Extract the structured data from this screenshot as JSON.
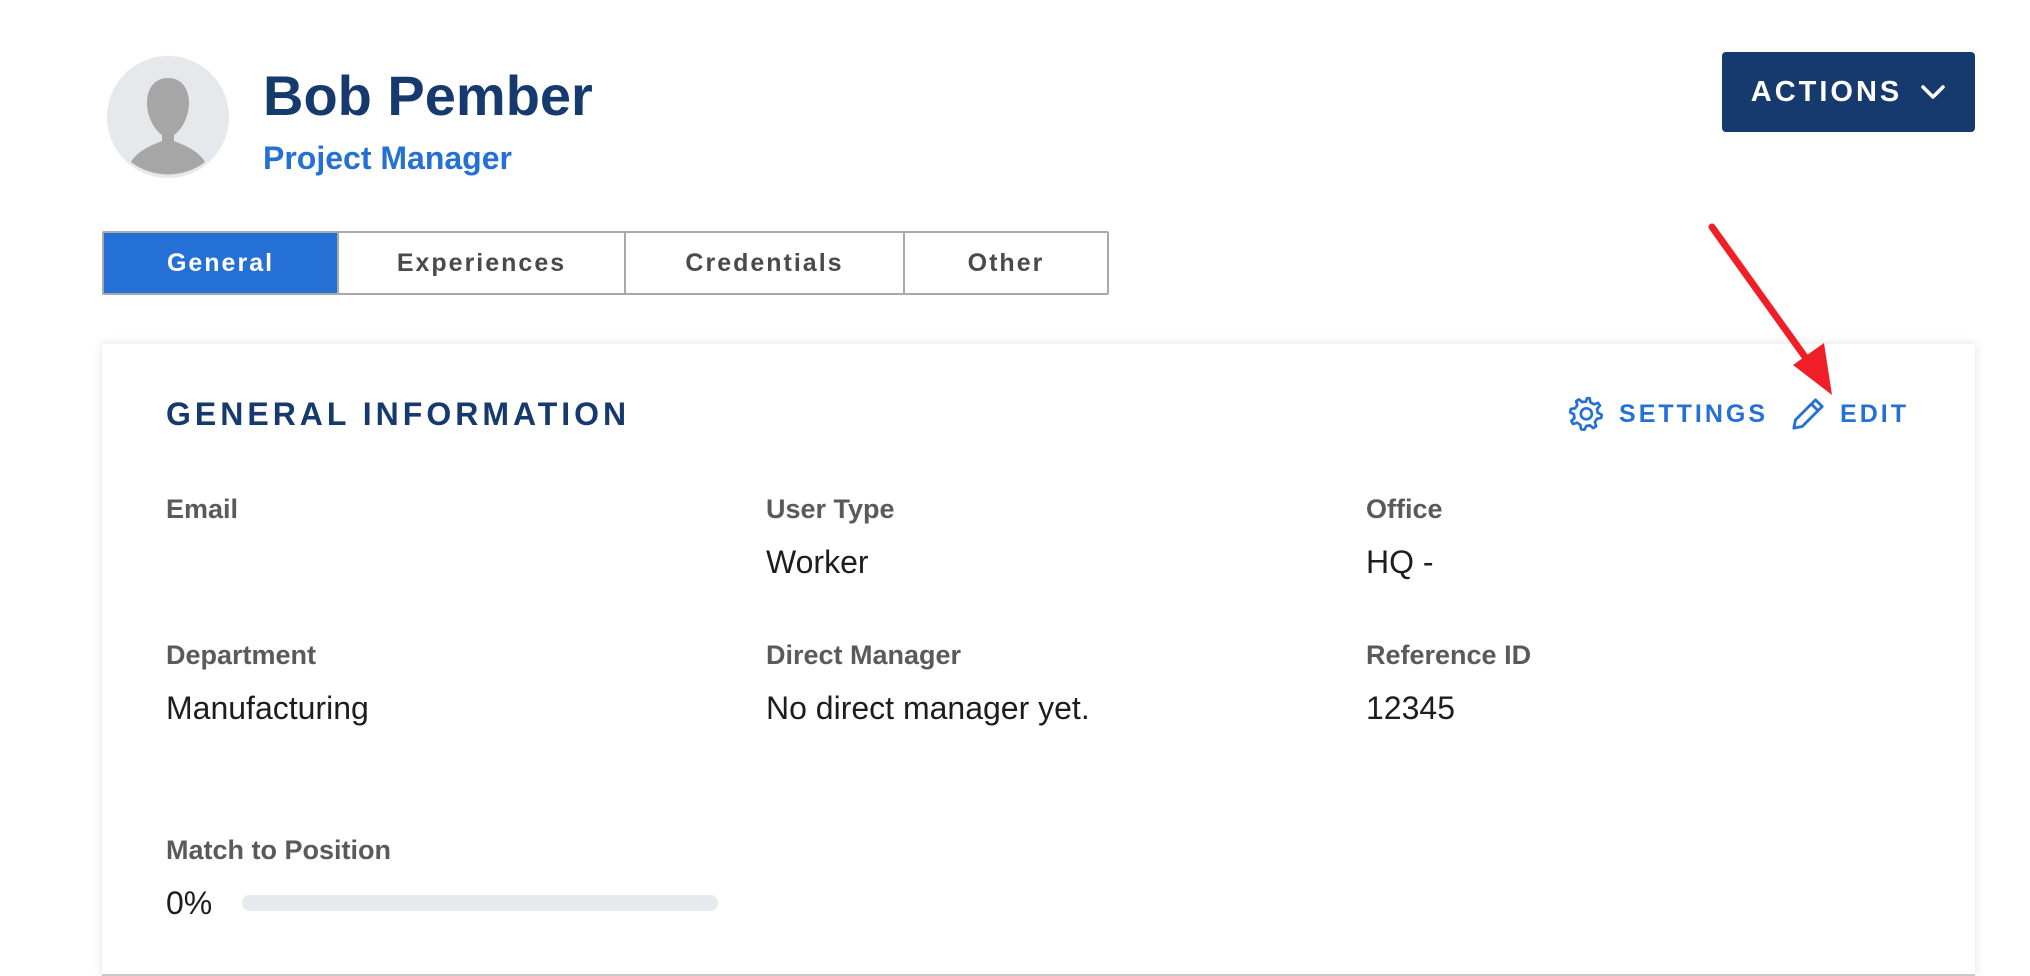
{
  "profile": {
    "name": "Bob Pember",
    "role": "Project Manager",
    "avatar_icon": "person-silhouette-icon"
  },
  "header": {
    "actions_label": "ACTIONS",
    "actions_icon": "chevron-down-icon"
  },
  "tabs": [
    {
      "label": "General",
      "active": true
    },
    {
      "label": "Experiences",
      "active": false
    },
    {
      "label": "Credentials",
      "active": false
    },
    {
      "label": "Other",
      "active": false
    }
  ],
  "card": {
    "title": "GENERAL INFORMATION",
    "settings_label": "SETTINGS",
    "settings_icon": "gear-icon",
    "edit_label": "EDIT",
    "edit_icon": "pencil-icon",
    "fields": {
      "email": {
        "label": "Email",
        "value": ""
      },
      "user_type": {
        "label": "User Type",
        "value": "Worker"
      },
      "office": {
        "label": "Office",
        "value": "HQ -"
      },
      "department": {
        "label": "Department",
        "value": "Manufacturing"
      },
      "direct_manager": {
        "label": "Direct Manager",
        "value": "No direct manager yet."
      },
      "reference_id": {
        "label": "Reference ID",
        "value": "12345"
      }
    },
    "match": {
      "label": "Match to Position",
      "percent_text": "0%",
      "progress": 0
    }
  },
  "colors": {
    "brand_navy": "#173a6e",
    "accent_blue": "#2570d4",
    "annotation_red": "#f01f27"
  }
}
